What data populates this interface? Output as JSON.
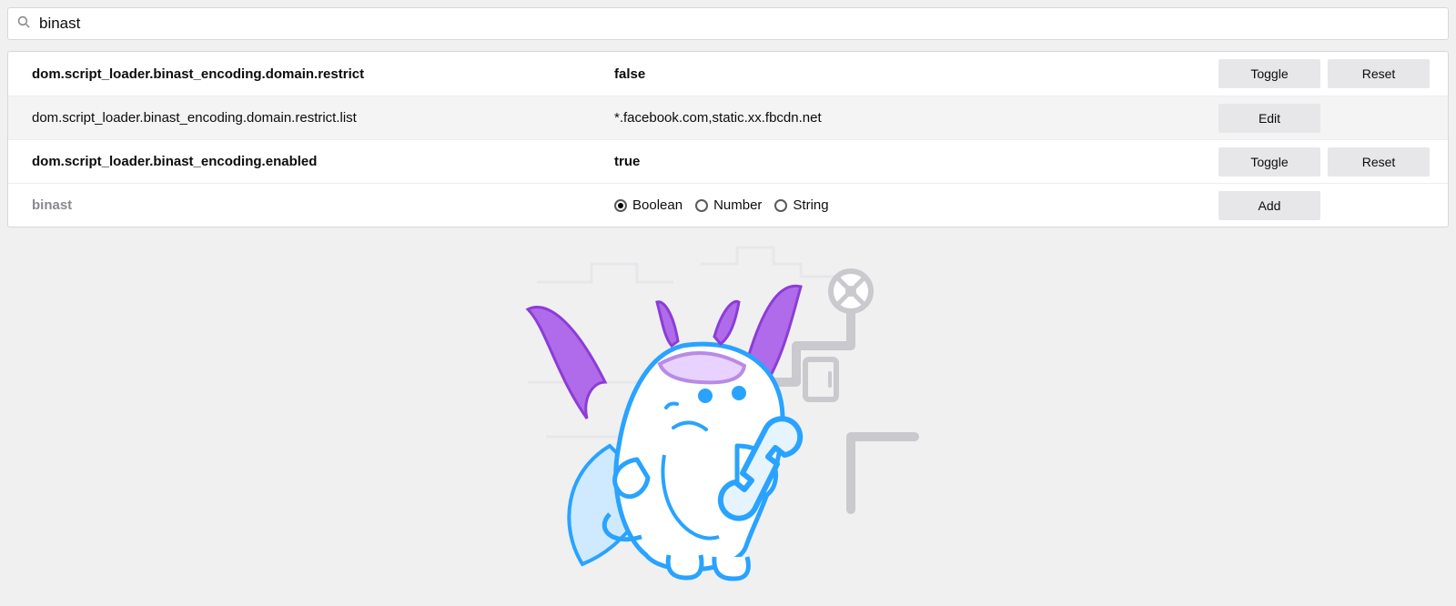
{
  "search": {
    "value": "binast"
  },
  "rows": [
    {
      "name": "dom.script_loader.binast_encoding.domain.restrict",
      "value": "false",
      "bold": true,
      "actions": {
        "primary": "Toggle",
        "secondary": "Reset"
      }
    },
    {
      "name": "dom.script_loader.binast_encoding.domain.restrict.list",
      "value": "*.facebook.com,static.xx.fbcdn.net",
      "bold": false,
      "actions": {
        "primary": "Edit"
      }
    },
    {
      "name": "dom.script_loader.binast_encoding.enabled",
      "value": "true",
      "bold": true,
      "actions": {
        "primary": "Toggle",
        "secondary": "Reset"
      }
    }
  ],
  "newPref": {
    "name": "binast",
    "types": [
      "Boolean",
      "Number",
      "String"
    ],
    "selected": "Boolean",
    "action": "Add"
  }
}
